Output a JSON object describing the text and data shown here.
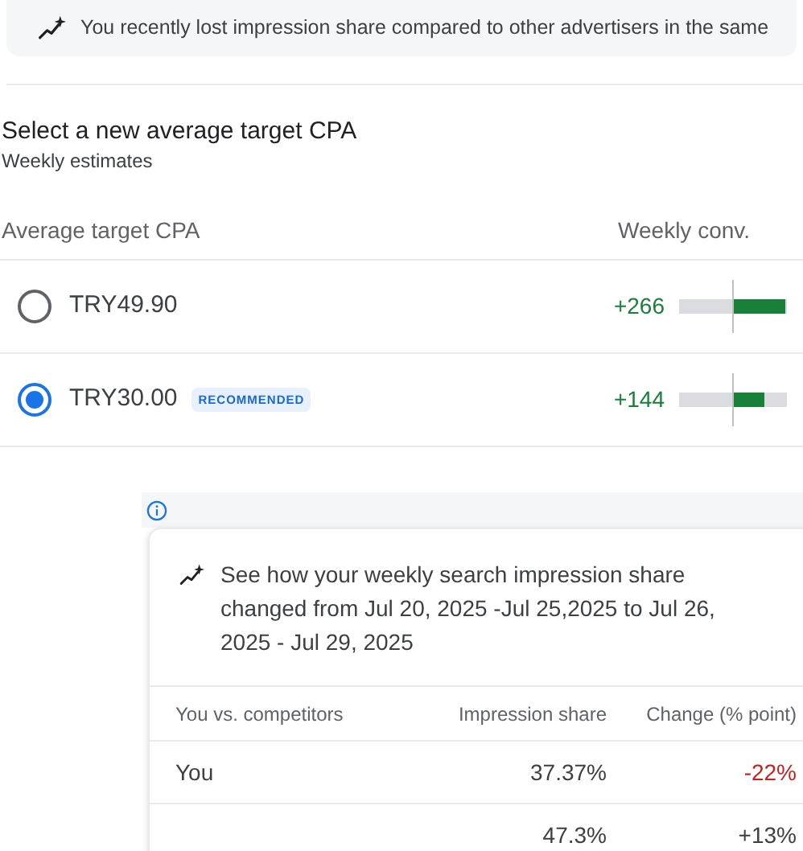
{
  "banner": {
    "text": "You recently lost impression share compared to other advertisers in the same"
  },
  "section": {
    "title": "Select a new average target CPA",
    "subtitle": "Weekly estimates"
  },
  "columns": [
    "Average target CPA",
    "Weekly conv."
  ],
  "options": [
    {
      "label": "TRY49.90",
      "selected": false,
      "conversions": "+266",
      "level": 0.97
    },
    {
      "label": "TRY30.00",
      "selected": true,
      "badge": "RECOMMENDED",
      "conversions": "+144",
      "level": 0.57
    }
  ],
  "popup": {
    "message": "See how your weekly search impression share changed from Jul 20, 2025 -Jul 25,2025 to Jul 26, 2025 - Jul 29, 2025",
    "columns": [
      "You vs. competitors",
      "Impression share",
      "Change (% point)"
    ],
    "rows": [
      {
        "name": "You",
        "share": "37.37%",
        "change": "-22%",
        "negative": true
      },
      {
        "share": "47.3%",
        "change": "+13%",
        "negative": false
      }
    ]
  }
}
